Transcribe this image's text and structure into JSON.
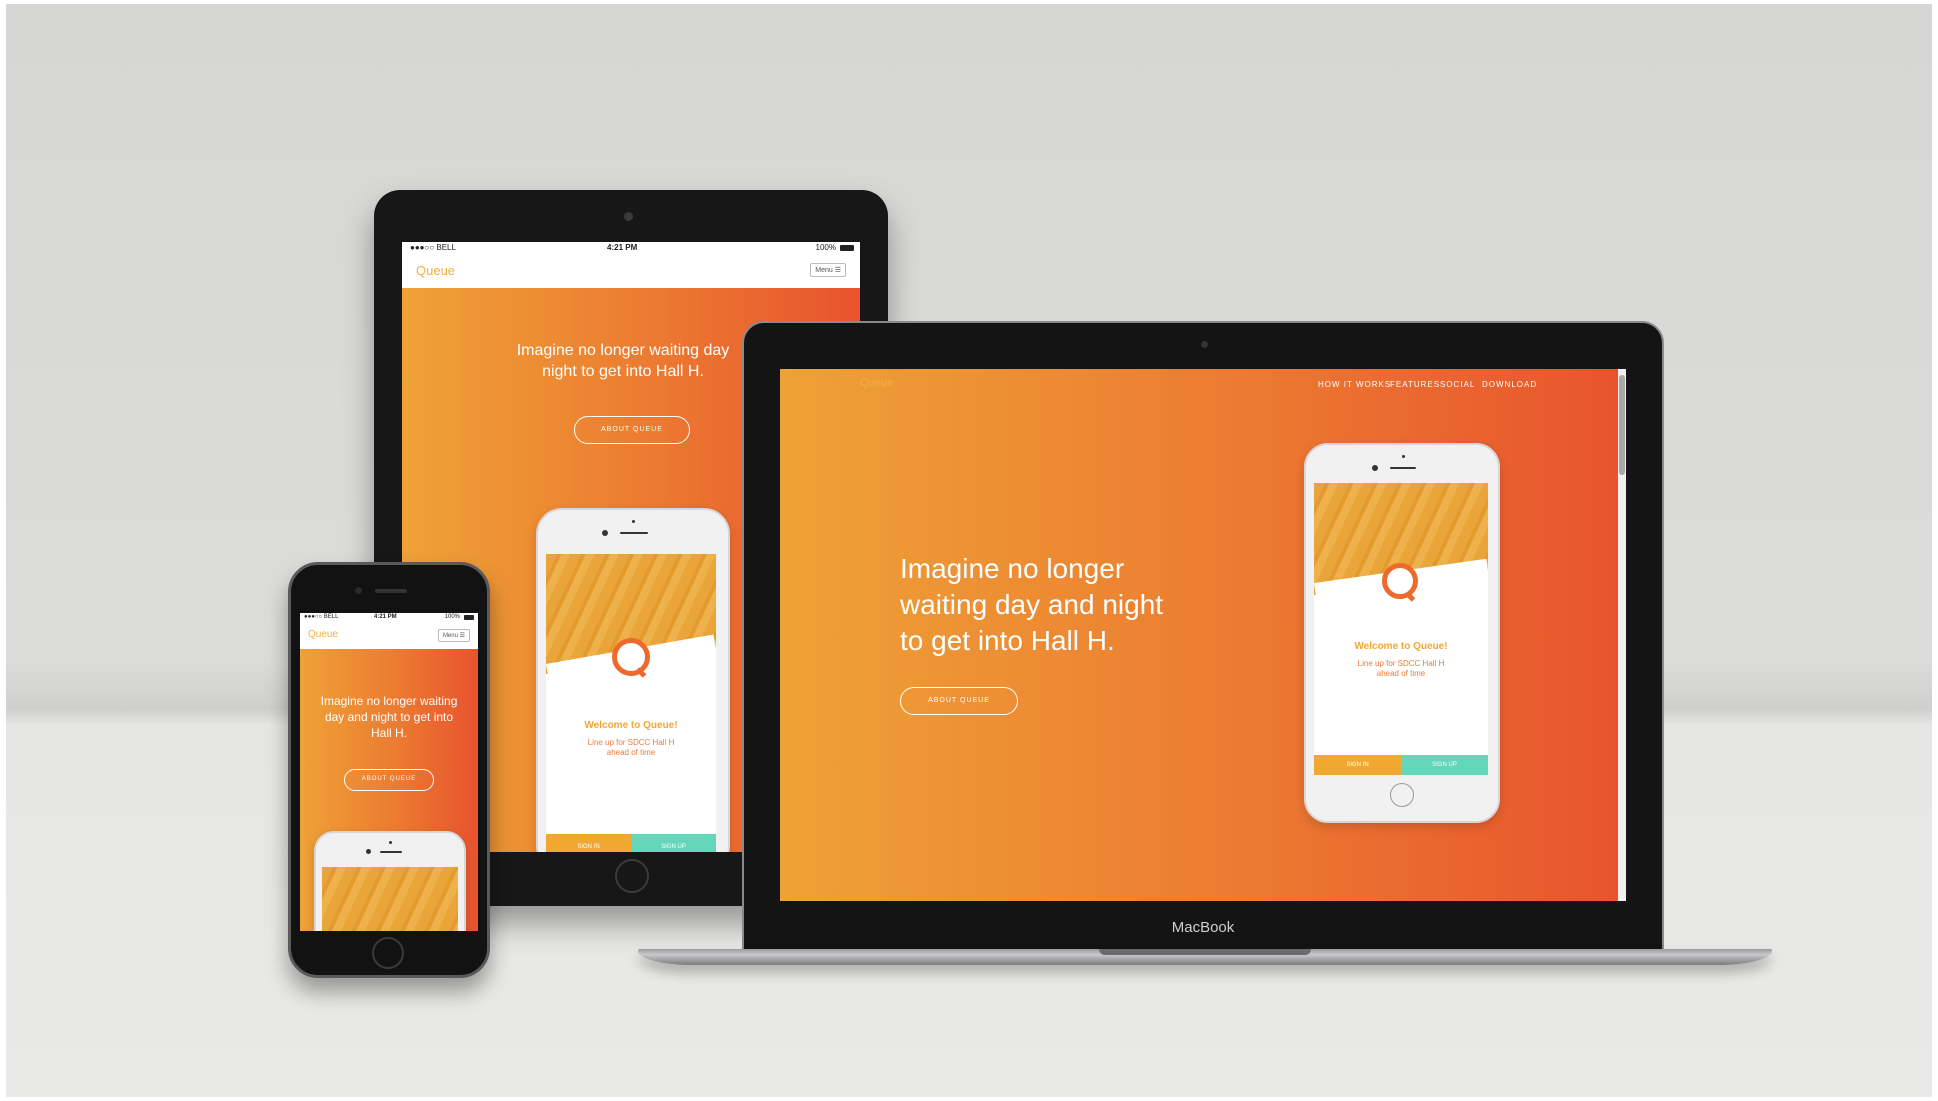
{
  "colors": {
    "gradient_start": "#eea236",
    "gradient_end": "#e8532e",
    "logo_color": "#f1b13a",
    "signup_color": "#63d7b9"
  },
  "brand": "Queue",
  "hero": {
    "headline": "Imagine no longer waiting day and night to get into Hall H.",
    "cta": "ABOUT QUEUE"
  },
  "statusbar": {
    "carrier": "●●●○○ BELL",
    "time": "4:21 PM",
    "battery": "100%"
  },
  "menu_label": "Menu ☰",
  "laptop": {
    "nav": [
      "HOW IT WORKS",
      "FEATURES",
      "SOCIAL",
      "DOWNLOAD"
    ],
    "headline_lines": [
      "Imagine no longer",
      "waiting day and night",
      "to get into Hall H."
    ],
    "brand_label": "MacBook"
  },
  "tablet": {
    "headline_lines": [
      "Imagine no longer waiting day",
      "night to get into Hall H."
    ]
  },
  "phone": {
    "headline_lines": [
      "Imagine no longer waiting",
      "day and night to get into",
      "Hall H."
    ]
  },
  "app_mock": {
    "welcome": "Welcome to Queue!",
    "subtitle_lines": [
      "Line up for SDCC Hall H",
      "ahead of time"
    ],
    "sign_in": "SIGN IN",
    "sign_up": "SIGN UP"
  },
  "icons": [
    "wifi-icon",
    "battery-icon",
    "hamburger-menu-icon",
    "queue-q-logo-icon",
    "camera-icon",
    "home-button-icon"
  ]
}
